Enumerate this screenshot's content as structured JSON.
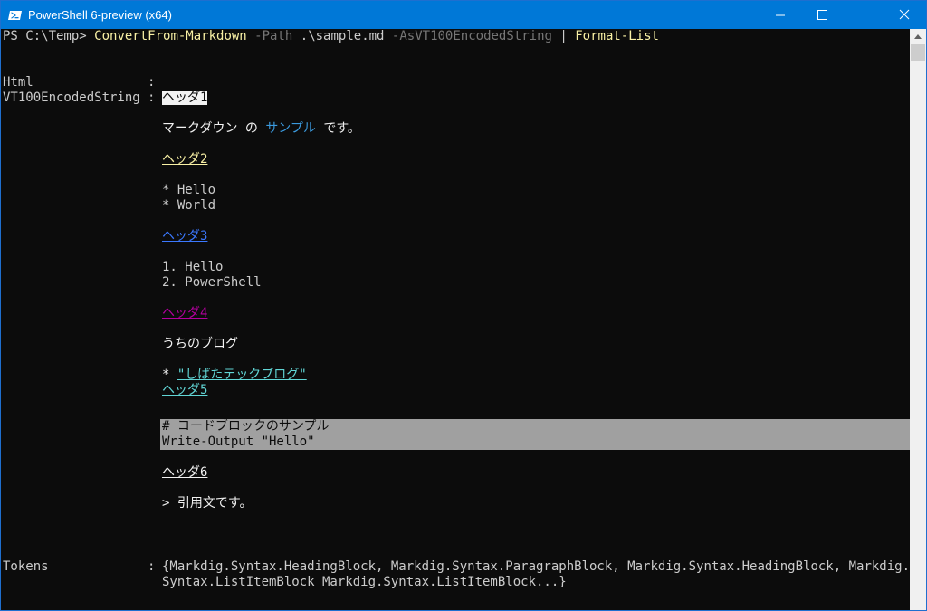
{
  "window": {
    "title": "PowerShell 6-preview (x64)"
  },
  "icons": {
    "app": "powershell-icon",
    "minimize": "minimize-icon",
    "maximize": "maximize-icon",
    "close": "close-icon",
    "scroll_up": "chevron-up-icon"
  },
  "colors": {
    "titlebar": "#0078d7",
    "background": "#0c0c0c",
    "foreground": "#cccccc",
    "command": "#f9f1a5",
    "parameter": "#767676",
    "string": "#3b9ade",
    "h3": "#3b78ff",
    "h4": "#b4009e",
    "h5": "#61d6d6",
    "code_bg": "#a0a0a0"
  },
  "console": {
    "prompt": "PS C:\\Temp> ",
    "command": {
      "cmdlet": "ConvertFrom-Markdown",
      "param1": "-Path",
      "arg1": ".\\sample.md",
      "param2": "-AsVT100EncodedString",
      "pipe": "|",
      "cmdlet2": "Format-List"
    },
    "fields": {
      "html_label": "Html",
      "vt100_label": "VT100EncodedString",
      "tokens_label": "Tokens",
      "separator": ":"
    },
    "output": {
      "h1": "ヘッダ1",
      "para1_a": "マークダウン の ",
      "para1_b": "サンプル",
      "para1_c": " です。",
      "h2": "ヘッダ2",
      "list1_item1": "* Hello",
      "list1_item2": "* World",
      "h3": "ヘッダ3",
      "list2_item1": "1. Hello",
      "list2_item2": "2. PowerShell",
      "h4": "ヘッダ4",
      "para2": "うちのブログ",
      "link_bullet": "* ",
      "link_text": "\"しばたテックブログ\"",
      "h5": "ヘッダ5",
      "code_line1": "# コードブロックのサンプル",
      "code_line2": "Write-Output \"Hello\"",
      "h6": "ヘッダ6",
      "quote": "> 引用文です。"
    },
    "tokens_line1": "{Markdig.Syntax.HeadingBlock, Markdig.Syntax.ParagraphBlock, Markdig.Syntax.HeadingBlock, Markdig.",
    "tokens_line2": "Syntax.ListItemBlock Markdig.Syntax.ListItemBlock...}"
  }
}
